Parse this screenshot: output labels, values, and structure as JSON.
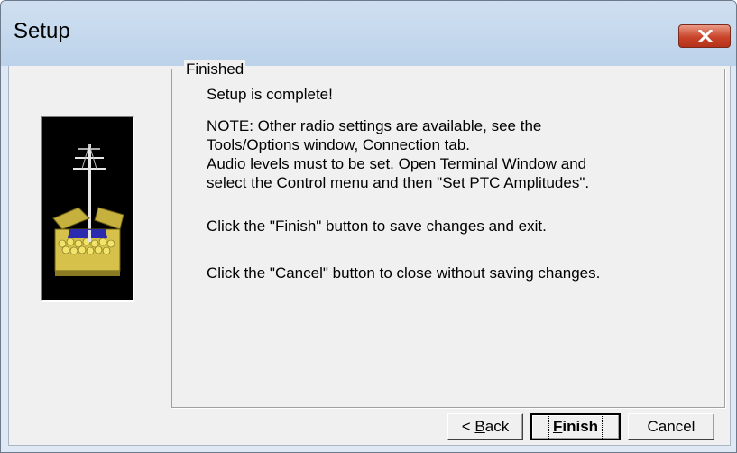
{
  "window": {
    "title": "Setup"
  },
  "group": {
    "title": "Finished"
  },
  "content": {
    "line1": "Setup is complete!",
    "line2": "NOTE: Other radio settings are available, see the",
    "line3": "Tools/Options window, Connection tab.",
    "line4": "Audio levels must to be set. Open Terminal Window and",
    "line5": "select the Control menu and then \"Set PTC Amplitudes\".",
    "line6": "Click the \"Finish\" button to save changes and exit.",
    "line7": "Click the \"Cancel\" button to close without saving changes."
  },
  "buttons": {
    "back_prefix": "< ",
    "back_label": "Back",
    "finish_label": "Finish",
    "cancel_label": "Cancel"
  },
  "icons": {
    "close": "close-icon",
    "wizard_image": "antenna-box-illustration"
  },
  "colors": {
    "title_bar": "#c7d9ee",
    "close_button": "#c9442a",
    "dialog_background": "#f0f0f0",
    "box": "#d6c14a"
  }
}
